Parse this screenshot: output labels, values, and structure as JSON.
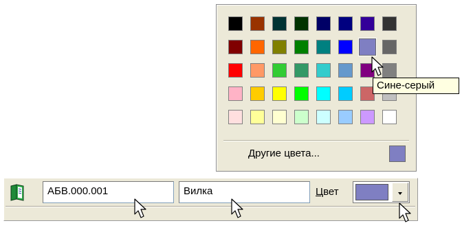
{
  "palette": {
    "rows": [
      [
        "#000000",
        "#993300",
        "#003333",
        "#003300",
        "#000066",
        "#000080",
        "#330099",
        "#333333"
      ],
      [
        "#800000",
        "#ff6600",
        "#808000",
        "#008000",
        "#008080",
        "#0000ff",
        "#7f7fc2",
        "#666666"
      ],
      [
        "#ff0000",
        "#ff9966",
        "#33cc33",
        "#339966",
        "#33cccc",
        "#6699cc",
        "#800080",
        "#808080"
      ],
      [
        "#ffb3c6",
        "#ffcc00",
        "#ffff00",
        "#00ff00",
        "#00ffff",
        "#00ccff",
        "#cc6666",
        "#c0c0c0"
      ],
      [
        "#ffdfdf",
        "#ffff99",
        "#ffffd0",
        "#ccffcc",
        "#ccffff",
        "#99ccff",
        "#cc99ff",
        "#ffffff"
      ]
    ],
    "hovered_color": "#7f7fc2",
    "more_colors_label": "Другие цвета...",
    "more_colors_swatch": "#7f7fc2"
  },
  "tooltip": {
    "text": "Сине-серый"
  },
  "toolbar": {
    "book_icon": "book-icon",
    "code_value": "АБВ.000.001",
    "name_value": "Вилка",
    "color_label_hotkey": "Ц",
    "color_label_rest": "вет",
    "selected_color": "#7f7fc2"
  }
}
